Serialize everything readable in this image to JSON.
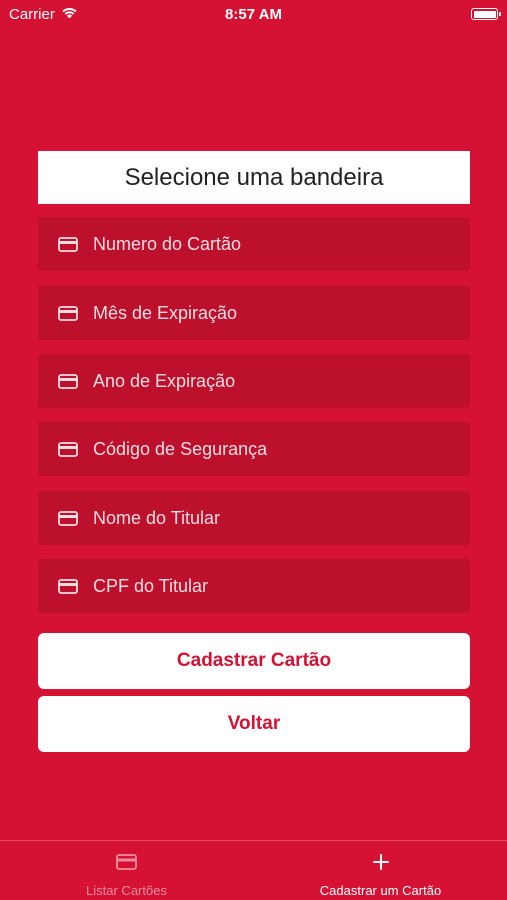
{
  "status_bar": {
    "carrier": "Carrier",
    "time": "8:57 AM"
  },
  "form": {
    "brand_select": "Selecione uma bandeira",
    "fields": [
      {
        "label": "Numero do Cartão",
        "icon": "credit-card-icon"
      },
      {
        "label": "Mês de Expiração",
        "icon": "credit-card-icon"
      },
      {
        "label": "Ano de Expiração",
        "icon": "credit-card-icon"
      },
      {
        "label": "Código de Segurança",
        "icon": "credit-card-icon"
      },
      {
        "label": "Nome do Titular",
        "icon": "credit-card-icon"
      },
      {
        "label": "CPF do Titular",
        "icon": "credit-card-icon"
      }
    ],
    "submit_label": "Cadastrar Cartão",
    "back_label": "Voltar"
  },
  "tab_bar": {
    "tabs": [
      {
        "label": "Listar Cartões",
        "icon": "credit-card-icon",
        "active": false
      },
      {
        "label": "Cadastrar um Cartão",
        "icon": "plus-icon",
        "active": true
      }
    ]
  },
  "colors": {
    "background": "#d51234",
    "field": "#bd102d",
    "button_text": "#d51234"
  }
}
